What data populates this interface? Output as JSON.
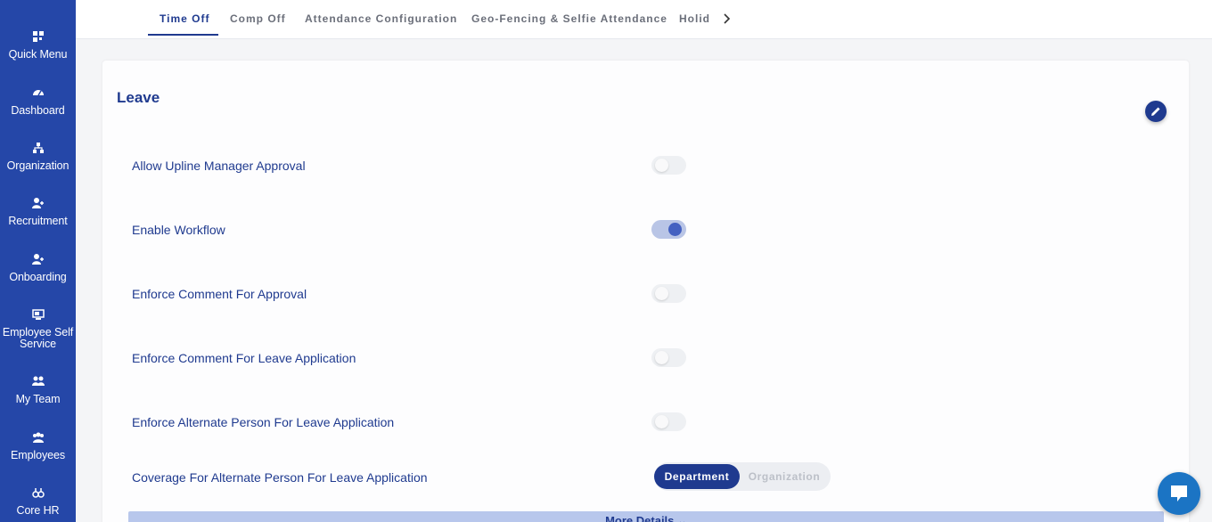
{
  "sidebar": {
    "items": [
      {
        "label": "Quick Menu",
        "icon": "quick-menu-icon"
      },
      {
        "label": "Dashboard",
        "icon": "dashboard-icon"
      },
      {
        "label": "Organization",
        "icon": "organization-icon"
      },
      {
        "label": "Recruitment",
        "icon": "recruitment-icon"
      },
      {
        "label": "Onboarding",
        "icon": "onboarding-icon"
      },
      {
        "label": "Employee Self Service",
        "icon": "employee-self-service-icon"
      },
      {
        "label": "My Team",
        "icon": "my-team-icon"
      },
      {
        "label": "Employees",
        "icon": "employees-icon"
      },
      {
        "label": "Core HR",
        "icon": "core-hr-icon"
      }
    ]
  },
  "tabs": [
    {
      "label": "Time Off",
      "active": true
    },
    {
      "label": "Comp Off",
      "active": false
    },
    {
      "label": "Attendance Configuration",
      "active": false
    },
    {
      "label": "Geo-Fencing & Selfie Attendance",
      "active": false
    },
    {
      "label": "Holid",
      "active": false
    }
  ],
  "card": {
    "title": "Leave",
    "settings": [
      {
        "label": "Allow Upline Manager Approval",
        "enabled": false
      },
      {
        "label": "Enable Workflow",
        "enabled": true
      },
      {
        "label": "Enforce Comment For Approval",
        "enabled": false
      },
      {
        "label": "Enforce Comment For Leave Application",
        "enabled": false
      },
      {
        "label": "Enforce Alternate Person For Leave Application",
        "enabled": false
      }
    ],
    "coverage": {
      "label": "Coverage For Alternate Person For Leave Application",
      "options": [
        "Department",
        "Organization"
      ],
      "selected": "Department"
    },
    "more_details": "More Details ⌄"
  },
  "colors": {
    "sidebar_bg": "#2547a8",
    "primary": "#1f3a8f",
    "chat": "#1b74c4"
  }
}
